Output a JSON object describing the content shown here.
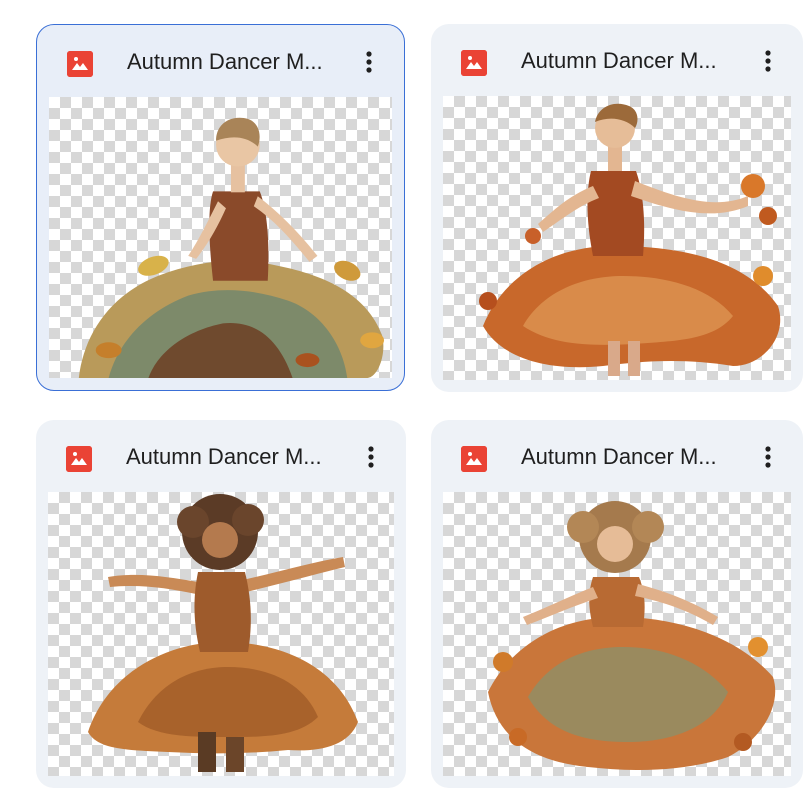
{
  "files": [
    {
      "title": "Autumn Dancer M...",
      "type_icon": "image-file-icon",
      "selected": true
    },
    {
      "title": "Autumn Dancer M...",
      "type_icon": "image-file-icon",
      "selected": false
    },
    {
      "title": "Autumn Dancer M...",
      "type_icon": "image-file-icon",
      "selected": false
    },
    {
      "title": "Autumn Dancer M...",
      "type_icon": "image-file-icon",
      "selected": false
    }
  ],
  "colors": {
    "icon_red": "#ea4335",
    "selected_border": "#3a6fd6",
    "card_bg": "#eef2f7"
  }
}
